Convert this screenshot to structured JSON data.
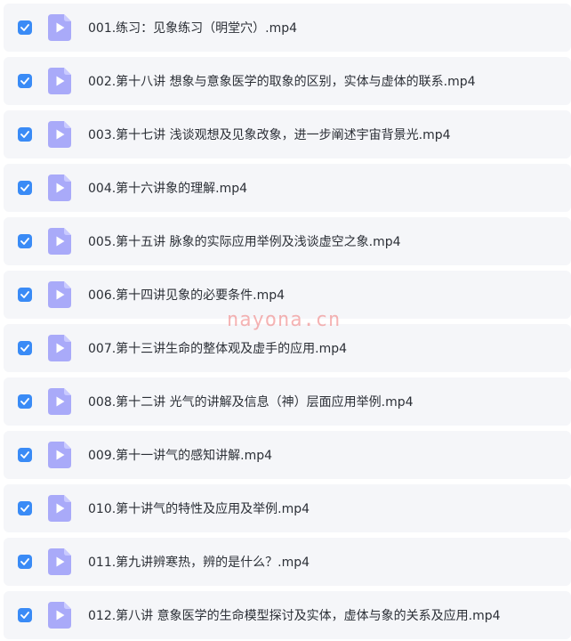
{
  "files": [
    {
      "name": "001.练习：见象练习（明堂穴）.mp4",
      "checked": true
    },
    {
      "name": "002.第十八讲 想象与意象医学的取象的区别，实体与虚体的联系.mp4",
      "checked": true
    },
    {
      "name": "003.第十七讲 浅谈观想及见象改象，进一步阐述宇宙背景光.mp4",
      "checked": true
    },
    {
      "name": "004.第十六讲象的理解.mp4",
      "checked": true
    },
    {
      "name": "005.第十五讲 脉象的实际应用举例及浅谈虚空之象.mp4",
      "checked": true
    },
    {
      "name": "006.第十四讲见象的必要条件.mp4",
      "checked": true
    },
    {
      "name": "007.第十三讲生命的整体观及虚手的应用.mp4",
      "checked": true
    },
    {
      "name": "008.第十二讲 光气的讲解及信息（神）层面应用举例.mp4",
      "checked": true
    },
    {
      "name": "009.第十一讲气的感知讲解.mp4",
      "checked": true
    },
    {
      "name": "010.第十讲气的特性及应用及举例.mp4",
      "checked": true
    },
    {
      "name": "011.第九讲辨寒热，辨的是什么？.mp4",
      "checked": true
    },
    {
      "name": "012.第八讲 意象医学的生命模型探讨及实体，虚体与象的关系及应用.mp4",
      "checked": true
    }
  ],
  "watermark": "nayona.cn",
  "colors": {
    "checkbox": "#3a8bf6",
    "file_icon": "#a9aaf9",
    "row_background": "#f5f6f9",
    "text": "#2b2f36"
  },
  "icons": {
    "checkbox": "checkmark-icon",
    "file": "video-file-icon"
  }
}
